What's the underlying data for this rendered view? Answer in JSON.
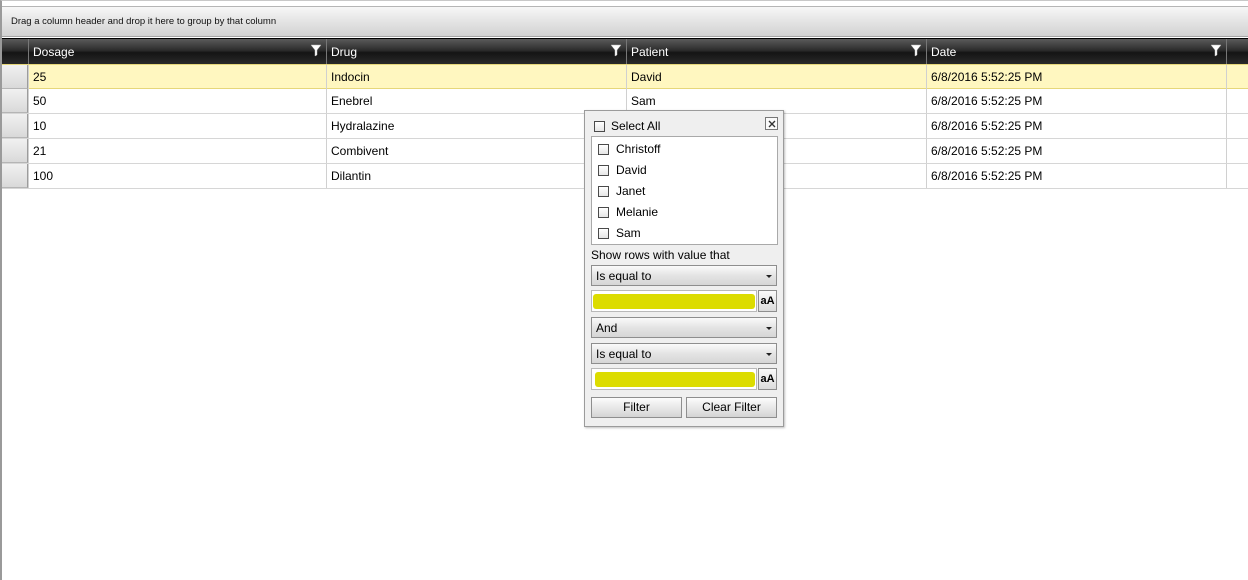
{
  "group_panel": {
    "hint": "Drag a column header and drop it here to group by that column"
  },
  "columns": [
    {
      "label": "Dosage",
      "filter_icon": "funnel-icon"
    },
    {
      "label": "Drug",
      "filter_icon": "funnel-icon"
    },
    {
      "label": "Patient",
      "filter_icon": "funnel-icon"
    },
    {
      "label": "Date",
      "filter_icon": "funnel-icon"
    }
  ],
  "rows": [
    {
      "dosage": "25",
      "drug": "Indocin",
      "patient": "David",
      "date": "6/8/2016 5:52:25 PM",
      "selected": true
    },
    {
      "dosage": "50",
      "drug": "Enebrel",
      "patient": "Sam",
      "date": "6/8/2016 5:52:25 PM",
      "selected": false
    },
    {
      "dosage": "10",
      "drug": "Hydralazine",
      "patient": "",
      "date": "6/8/2016 5:52:25 PM",
      "selected": false
    },
    {
      "dosage": "21",
      "drug": "Combivent",
      "patient": "",
      "date": "6/8/2016 5:52:25 PM",
      "selected": false
    },
    {
      "dosage": "100",
      "drug": "Dilantin",
      "patient": "",
      "date": "6/8/2016 5:52:25 PM",
      "selected": false
    }
  ],
  "filter_popup": {
    "select_all_label": "Select All",
    "close_icon": "close-icon",
    "values": [
      {
        "label": "Christoff",
        "checked": false
      },
      {
        "label": "David",
        "checked": false
      },
      {
        "label": "Janet",
        "checked": false
      },
      {
        "label": "Melanie",
        "checked": false
      },
      {
        "label": "Sam",
        "checked": false
      }
    ],
    "show_rows_label": "Show rows with value that",
    "operator1": "Is equal to",
    "value1": "",
    "match_case_label": "aA",
    "logical_operator": "And",
    "operator2": "Is equal to",
    "value2": "",
    "filter_button": "Filter",
    "clear_button": "Clear Filter",
    "highlight_color": "#dcdc00"
  },
  "colors": {
    "selected_row": "#fff7c0",
    "header_bg": "#1e1e1e"
  }
}
